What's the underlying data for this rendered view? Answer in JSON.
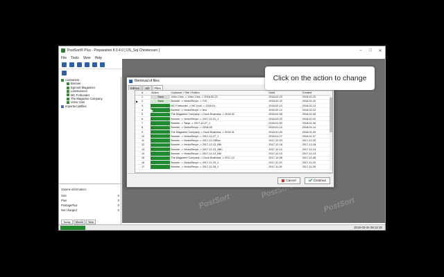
{
  "window": {
    "title": "PostSort® Plus - Preparation 8.0.4.0 [ DS_Sql Christensen ]"
  },
  "menu": [
    "File",
    "Tools",
    "View",
    "Help"
  ],
  "tree": {
    "root": "Customers",
    "customers": [
      "Bonnier",
      "Egmont Magasiner",
      "Larmkvinnen",
      "MC Forbundet",
      "The Magazine Company",
      "Volvo Cars"
    ],
    "imported": "Imported jobfiles"
  },
  "volume": {
    "heading": "Volume information:",
    "rows": [
      {
        "label": "Sort",
        "value": "0"
      },
      {
        "label": "Plus",
        "value": "0"
      },
      {
        "label": "PostagePlus",
        "value": "0"
      },
      {
        "label": "Not charged",
        "value": "0"
      }
    ],
    "tabs": [
      "Today",
      "Month",
      "Year"
    ]
  },
  "status": {
    "datetime": "2018-03-26 08:10:30"
  },
  "watermark": "PostSort",
  "dialog": {
    "title": "Removal of files",
    "tabs": [
      "Edition",
      "Job",
      "Files"
    ],
    "columns": [
      "#",
      "Action",
      "Customer / Title / Edition",
      "Used",
      "Created"
    ],
    "rows": [
      {
        "n": "1",
        "action": "Save",
        "text": "Volvo Cars -> Volvo Cars -> 2018-02-22",
        "used": "2018-02-22",
        "created": "2018-02-22",
        "style": "grey"
      },
      {
        "n": "2",
        "action": "Save",
        "text": "Bonnier -> VeckoRevyn -> Y10",
        "used": "2018-02-22",
        "created": "2018-02-22",
        "style": "light"
      },
      {
        "n": "3",
        "action": "",
        "text": "MC Förbundet -> MC Kroll -> 2018-01",
        "used": "2018-02-13",
        "created": "2018-02-13",
        "style": "green"
      },
      {
        "n": "4",
        "action": "",
        "text": "Bonnier -> VeckoRevyn -> test",
        "used": "2018-02-12",
        "created": "2018-02-12",
        "style": "green"
      },
      {
        "n": "5",
        "action": "",
        "text": "The Magazine Company -> Duck Business -> 2018-02",
        "used": "2018-02-08",
        "created": "2018-02-08",
        "style": "green"
      },
      {
        "n": "6",
        "action": "",
        "text": "Bonnier -> VeckoRevyn -> 2017-12-31_1",
        "used": "2018-02-02",
        "created": "2018-02-02",
        "style": "green"
      },
      {
        "n": "7",
        "action": "",
        "text": "Bonnier -> Tanja -> 2017-12-27_1",
        "used": "2018-01-30",
        "created": "2018-01-30",
        "style": "green"
      },
      {
        "n": "8",
        "action": "",
        "text": "Bonnier -> VeckoRevyn -> 2018-08",
        "used": "2018-01-14",
        "created": "2018-01-14",
        "style": "green"
      },
      {
        "n": "9",
        "action": "",
        "text": "The Magazine Company -> Duck Business -> 2018-01",
        "used": "2018-01-09",
        "created": "2018-01-09",
        "style": "green"
      },
      {
        "n": "10",
        "action": "",
        "text": "Bonnier -> VeckoRevyn -> 2017-12-27_1",
        "used": "2018-01-07",
        "created": "2018-01-07",
        "style": "green"
      },
      {
        "n": "11",
        "action": "",
        "text": "Bonnier -> VeckoRevyn -> 2017-12-13Box",
        "used": "2017-12-20",
        "created": "2017-12-20",
        "style": "green"
      },
      {
        "n": "12",
        "action": "",
        "text": "Bonnier -> VeckoRevyn -> 2017-12-13_BM",
        "used": "2017-12-18",
        "created": "2017-12-18",
        "style": "green"
      },
      {
        "n": "13",
        "action": "",
        "text": "Bonnier -> VeckoRevyn -> 2017-12-13_ABC",
        "used": "2017-12-14",
        "created": "2017-12-14",
        "style": "green"
      },
      {
        "n": "14",
        "action": "",
        "text": "Bonnier -> VeckoRevyn -> 2017-12-13_BM",
        "used": "2017-12-13",
        "created": "2017-12-13",
        "style": "green"
      },
      {
        "n": "15",
        "action": "",
        "text": "The Magazine Company -> Duck Business -> 2017-12",
        "used": "2017-12-08",
        "created": "2017-12-08",
        "style": "green"
      },
      {
        "n": "16",
        "action": "",
        "text": "Bonnier -> VeckoRevyn -> 2017-11-29_1",
        "used": "2017-11-29",
        "created": "2017-11-29",
        "style": "green"
      },
      {
        "n": "17",
        "action": "",
        "text": "Bonnier -> VeckoRevyn -> 2017-11-28_1",
        "used": "2017-11-28",
        "created": "2017-11-28",
        "style": "green"
      }
    ],
    "cancel_label": "Cancel",
    "continue_label": "Continue"
  },
  "callout": {
    "text": "Click on the action to change"
  },
  "colors": {
    "action_green": "#1f8a2e",
    "background": "#6e6e6e"
  }
}
